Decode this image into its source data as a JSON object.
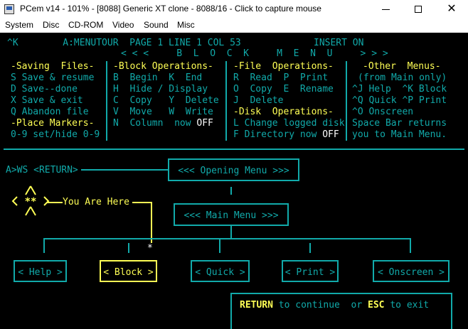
{
  "window": {
    "title": "PCem v14 - 101% - [8088] Generic XT clone - 8088/16 - Click to capture mouse",
    "minimize_label": "",
    "maximize_label": "",
    "close_label": "✕"
  },
  "menubar": [
    "System",
    "Disc",
    "CD-ROM",
    "Video",
    "Sound",
    "Misc"
  ],
  "status": {
    "left": "^K        A:MENUTOUR  PAGE 1 LINE 1 COL 53",
    "right": "INSERT ON",
    "block_menu_title": "< < <     B  L  O  C  K     M  E  N  U     > > >"
  },
  "saving": {
    "title": "-Saving  Files-",
    "items": [
      "S Save & resume",
      "D Save--done",
      "X Save & exit",
      "Q Abandon file"
    ],
    "markers_title": "-Place Markers-",
    "markers_item": "0-9 set/hide 0-9"
  },
  "block_ops": {
    "title": "-Block Operations-",
    "items": [
      "B  Begin  K  End",
      "H  Hide / Display",
      "C  Copy   Y  Delete",
      "V  Move   W  Write"
    ],
    "column_prefix": "N  Column  now ",
    "column_value": "OFF"
  },
  "file_ops": {
    "title": "-File  Operations-",
    "items": [
      "R  Read  P  Print",
      "O  Copy  E  Rename",
      "J  Delete"
    ],
    "disk_title": "-Disk  Operations-",
    "disk_items": [
      "L Change logged disk"
    ],
    "dir_prefix": "F Directory now ",
    "dir_value": "OFF"
  },
  "other": {
    "title": "-Other  Menus-",
    "items": [
      "(from Main only)",
      "^J Help  ^K Block",
      "^Q Quick ^P Print",
      "^O Onscreen",
      "Space Bar returns",
      "you to Main Menu."
    ]
  },
  "diagram": {
    "prompt": "A>WS <RETURN>",
    "opening_menu": "<<< Opening Menu >>>",
    "main_menu": "<<< Main Menu >>>",
    "you_are_here": "You Are Here",
    "marker_asterisk": "*",
    "nodes": [
      "< Help >",
      "< Block >",
      "< Quick >",
      "< Print >",
      "< Onscreen >"
    ],
    "selected_node": "< Block >"
  },
  "footer": {
    "return_key": "RETURN",
    "continue_text": " to continue  or ",
    "esc_key": "ESC",
    "exit_text": " to exit"
  },
  "colors": {
    "screen_bg": "#000000",
    "cyan": "#11aaaa",
    "yellow": "#ffff55",
    "white": "#ffffff"
  }
}
